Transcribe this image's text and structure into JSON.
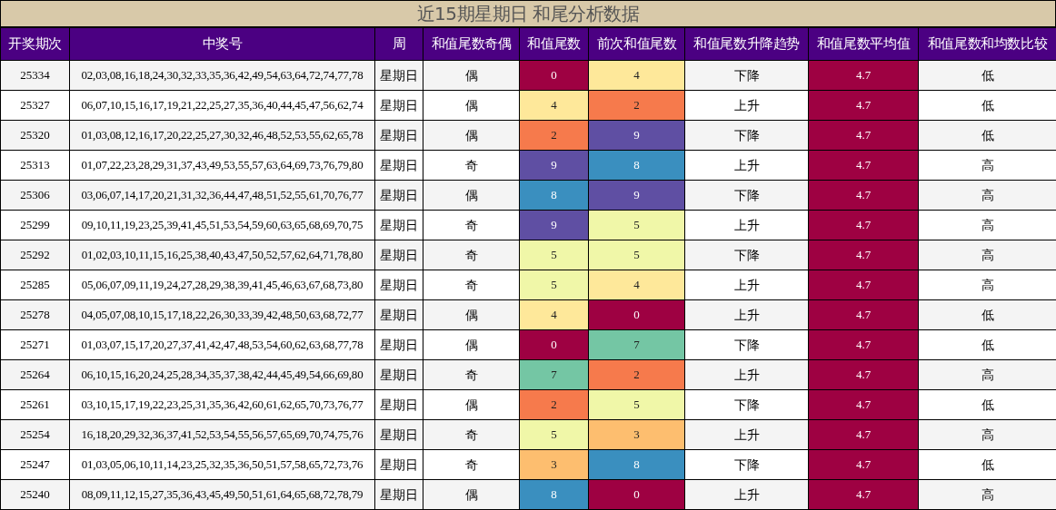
{
  "title": "近15期星期日 和尾分析数据",
  "columns": [
    "开奖期次",
    "中奖号",
    "周",
    "和值尾数奇偶",
    "和值尾数",
    "前次和值尾数",
    "和值尾数升降趋势",
    "和值尾数平均值",
    "和值尾数和均数比较"
  ],
  "rows": [
    {
      "issue": "25334",
      "numbers": "02,03,08,16,18,24,30,32,33,35,36,42,49,54,63,64,72,74,77,78",
      "week": "星期日",
      "parity": "偶",
      "tail": {
        "value": "0",
        "color": "#9e0142"
      },
      "prev_tail": {
        "value": "4",
        "color": "#fee89a"
      },
      "trend": "下降",
      "avg": {
        "value": "4.7",
        "color": "#9e0142"
      },
      "compare": "低"
    },
    {
      "issue": "25327",
      "numbers": "06,07,10,15,16,17,19,21,22,25,27,35,36,40,44,45,47,56,62,74",
      "week": "星期日",
      "parity": "偶",
      "tail": {
        "value": "4",
        "color": "#fee89a"
      },
      "prev_tail": {
        "value": "2",
        "color": "#f67a4c"
      },
      "trend": "上升",
      "avg": {
        "value": "4.7",
        "color": "#9e0142"
      },
      "compare": "低"
    },
    {
      "issue": "25320",
      "numbers": "01,03,08,12,16,17,20,22,25,27,30,32,46,48,52,53,55,62,65,78",
      "week": "星期日",
      "parity": "偶",
      "tail": {
        "value": "2",
        "color": "#f67a4c"
      },
      "prev_tail": {
        "value": "9",
        "color": "#5f4fa3"
      },
      "trend": "下降",
      "avg": {
        "value": "4.7",
        "color": "#9e0142"
      },
      "compare": "低"
    },
    {
      "issue": "25313",
      "numbers": "01,07,22,23,28,29,31,37,43,49,53,55,57,63,64,69,73,76,79,80",
      "week": "星期日",
      "parity": "奇",
      "tail": {
        "value": "9",
        "color": "#5f4fa3"
      },
      "prev_tail": {
        "value": "8",
        "color": "#3a8fbf"
      },
      "trend": "上升",
      "avg": {
        "value": "4.7",
        "color": "#9e0142"
      },
      "compare": "高"
    },
    {
      "issue": "25306",
      "numbers": "03,06,07,14,17,20,21,31,32,36,44,47,48,51,52,55,61,70,76,77",
      "week": "星期日",
      "parity": "偶",
      "tail": {
        "value": "8",
        "color": "#3a8fbf"
      },
      "prev_tail": {
        "value": "9",
        "color": "#5f4fa3"
      },
      "trend": "下降",
      "avg": {
        "value": "4.7",
        "color": "#9e0142"
      },
      "compare": "高"
    },
    {
      "issue": "25299",
      "numbers": "09,10,11,19,23,25,39,41,45,51,53,54,59,60,63,65,68,69,70,75",
      "week": "星期日",
      "parity": "奇",
      "tail": {
        "value": "9",
        "color": "#5f4fa3"
      },
      "prev_tail": {
        "value": "5",
        "color": "#f0f7a8"
      },
      "trend": "上升",
      "avg": {
        "value": "4.7",
        "color": "#9e0142"
      },
      "compare": "高"
    },
    {
      "issue": "25292",
      "numbers": "01,02,03,10,11,15,16,25,38,40,43,47,50,52,57,62,64,71,78,80",
      "week": "星期日",
      "parity": "奇",
      "tail": {
        "value": "5",
        "color": "#f0f7a8"
      },
      "prev_tail": {
        "value": "5",
        "color": "#f0f7a8"
      },
      "trend": "下降",
      "avg": {
        "value": "4.7",
        "color": "#9e0142"
      },
      "compare": "高"
    },
    {
      "issue": "25285",
      "numbers": "05,06,07,09,11,19,24,27,28,29,38,39,41,45,46,63,67,68,73,80",
      "week": "星期日",
      "parity": "奇",
      "tail": {
        "value": "5",
        "color": "#f0f7a8"
      },
      "prev_tail": {
        "value": "4",
        "color": "#fee89a"
      },
      "trend": "上升",
      "avg": {
        "value": "4.7",
        "color": "#9e0142"
      },
      "compare": "高"
    },
    {
      "issue": "25278",
      "numbers": "04,05,07,08,10,15,17,18,22,26,30,33,39,42,48,50,63,68,72,77",
      "week": "星期日",
      "parity": "偶",
      "tail": {
        "value": "4",
        "color": "#fee89a"
      },
      "prev_tail": {
        "value": "0",
        "color": "#9e0142"
      },
      "trend": "上升",
      "avg": {
        "value": "4.7",
        "color": "#9e0142"
      },
      "compare": "低"
    },
    {
      "issue": "25271",
      "numbers": "01,03,07,15,17,20,27,37,41,42,47,48,53,54,60,62,63,68,77,78",
      "week": "星期日",
      "parity": "偶",
      "tail": {
        "value": "0",
        "color": "#9e0142"
      },
      "prev_tail": {
        "value": "7",
        "color": "#74c6a4"
      },
      "trend": "下降",
      "avg": {
        "value": "4.7",
        "color": "#9e0142"
      },
      "compare": "低"
    },
    {
      "issue": "25264",
      "numbers": "06,10,15,16,20,24,25,28,34,35,37,38,42,44,45,49,54,66,69,80",
      "week": "星期日",
      "parity": "奇",
      "tail": {
        "value": "7",
        "color": "#74c6a4"
      },
      "prev_tail": {
        "value": "2",
        "color": "#f67a4c"
      },
      "trend": "上升",
      "avg": {
        "value": "4.7",
        "color": "#9e0142"
      },
      "compare": "高"
    },
    {
      "issue": "25261",
      "numbers": "03,10,15,17,19,22,23,25,31,35,36,42,60,61,62,65,70,73,76,77",
      "week": "星期日",
      "parity": "偶",
      "tail": {
        "value": "2",
        "color": "#f67a4c"
      },
      "prev_tail": {
        "value": "5",
        "color": "#f0f7a8"
      },
      "trend": "下降",
      "avg": {
        "value": "4.7",
        "color": "#9e0142"
      },
      "compare": "低"
    },
    {
      "issue": "25254",
      "numbers": "16,18,20,29,32,36,37,41,52,53,54,55,56,57,65,69,70,74,75,76",
      "week": "星期日",
      "parity": "奇",
      "tail": {
        "value": "5",
        "color": "#f0f7a8"
      },
      "prev_tail": {
        "value": "3",
        "color": "#fdbe6f"
      },
      "trend": "上升",
      "avg": {
        "value": "4.7",
        "color": "#9e0142"
      },
      "compare": "高"
    },
    {
      "issue": "25247",
      "numbers": "01,03,05,06,10,11,14,23,25,32,35,36,50,51,57,58,65,72,73,76",
      "week": "星期日",
      "parity": "奇",
      "tail": {
        "value": "3",
        "color": "#fdbe6f"
      },
      "prev_tail": {
        "value": "8",
        "color": "#3a8fbf"
      },
      "trend": "下降",
      "avg": {
        "value": "4.7",
        "color": "#9e0142"
      },
      "compare": "低"
    },
    {
      "issue": "25240",
      "numbers": "08,09,11,12,15,27,35,36,43,45,49,50,51,61,64,65,68,72,78,79",
      "week": "星期日",
      "parity": "偶",
      "tail": {
        "value": "8",
        "color": "#3a8fbf"
      },
      "prev_tail": {
        "value": "0",
        "color": "#9e0142"
      },
      "trend": "上升",
      "avg": {
        "value": "4.7",
        "color": "#9e0142"
      },
      "compare": "高"
    }
  ]
}
